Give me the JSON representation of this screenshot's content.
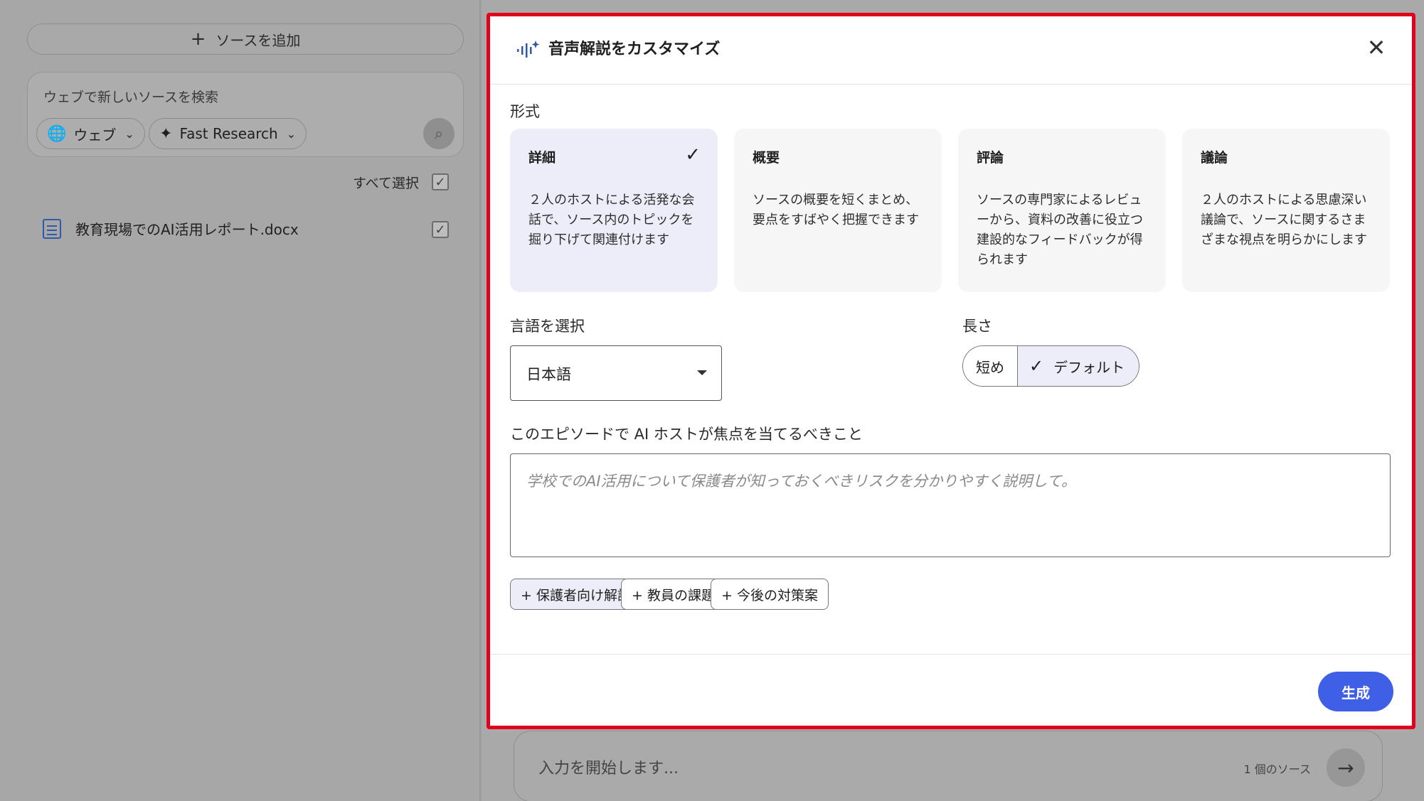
{
  "left": {
    "add_source_label": "ソースを追加",
    "search_hint": "ウェブで新しいソースを検索",
    "chip_web": "ウェブ",
    "chip_research": "Fast Research",
    "select_all": "すべて選択",
    "source_file": "教育現場でのAI活用レポート.docx"
  },
  "chat": {
    "placeholder": "入力を開始します...",
    "source_count": "1 個のソース"
  },
  "dialog": {
    "title": "音声解説をカスタマイズ",
    "format_label": "形式",
    "formats": [
      {
        "title": "詳細",
        "desc": "２人のホストによる活発な会話で、ソース内のトピックを掘り下げて関連付けます",
        "selected": true
      },
      {
        "title": "概要",
        "desc": "ソースの概要を短くまとめ、要点をすばやく把握できます",
        "selected": false
      },
      {
        "title": "評論",
        "desc": "ソースの専門家によるレビューから、資料の改善に役立つ建設的なフィードバックが得られます",
        "selected": false
      },
      {
        "title": "議論",
        "desc": "２人のホストによる思慮深い議論で、ソースに関するさまざまな視点を明らかにします",
        "selected": false
      }
    ],
    "language_label": "言語を選択",
    "language_value": "日本語",
    "length_label": "長さ",
    "length_options": {
      "short": "短め",
      "default": "デフォルト"
    },
    "focus_label": "このエピソードで AI ホストが焦点を当てるべきこと",
    "focus_placeholder": "学校でのAI活用について保護者が知っておくべきリスクを分かりやすく説明して。",
    "suggestions": [
      "+ 保護者向け解説",
      "+ 教員の課題",
      "+ 今後の対策案"
    ],
    "generate_label": "生成"
  }
}
